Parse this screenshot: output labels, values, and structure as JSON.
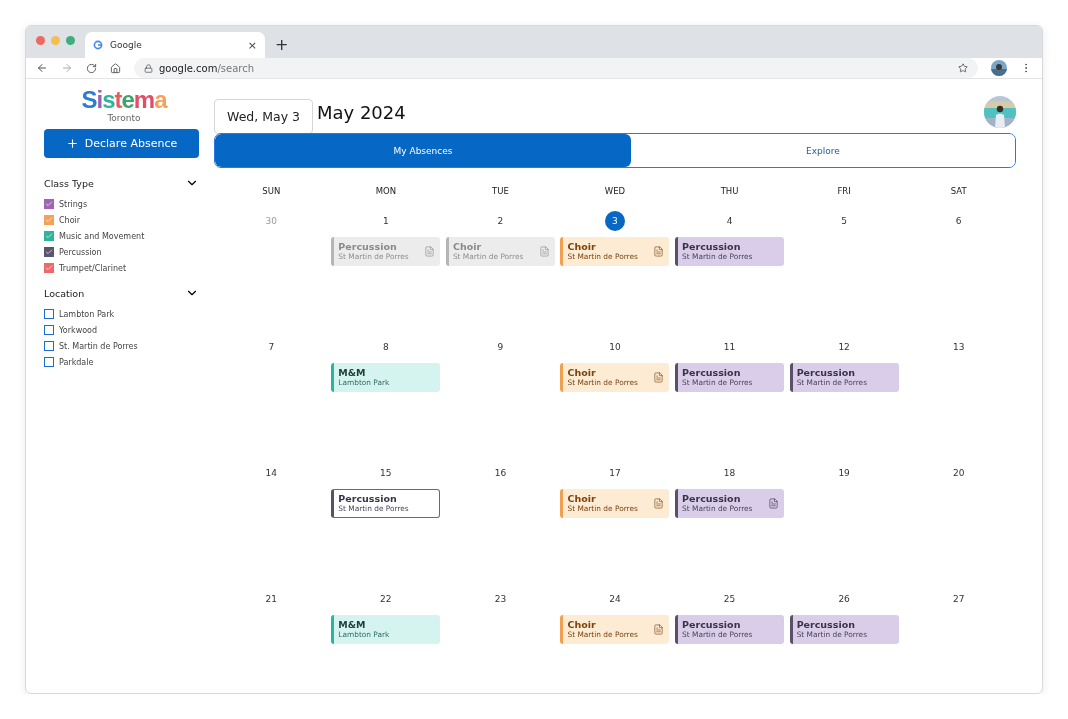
{
  "browser": {
    "tab_title": "Google",
    "new_tab": "+",
    "close_tab": "×",
    "url_host": "google.com",
    "url_path": "/search"
  },
  "sidebar": {
    "logo": "Sistema",
    "logo_sub": "Toronto",
    "declare_button": "Declare Absence",
    "sections": [
      {
        "title": "Class Type",
        "expanded": true,
        "items": [
          {
            "label": "Strings",
            "checked": true,
            "color": "#a064b4"
          },
          {
            "label": "Choir",
            "checked": true,
            "color": "#f4a259"
          },
          {
            "label": "Music and Movement",
            "checked": true,
            "color": "#2fb39b"
          },
          {
            "label": "Percussion",
            "checked": true,
            "color": "#5b5470"
          },
          {
            "label": "Trumpet/Clarinet",
            "checked": true,
            "color": "#ee6a6a"
          }
        ]
      },
      {
        "title": "Location",
        "expanded": true,
        "items": [
          {
            "label": "Lambton Park",
            "checked": false,
            "color": "#1a6fd0"
          },
          {
            "label": "Yorkwood",
            "checked": false,
            "color": "#1a6fd0"
          },
          {
            "label": "St. Martin de Porres",
            "checked": false,
            "color": "#1a6fd0"
          },
          {
            "label": "Parkdale",
            "checked": false,
            "color": "#1a6fd0"
          }
        ]
      }
    ]
  },
  "header": {
    "date_button": "Wed, May 3",
    "month_title": "May 2024"
  },
  "tabs": [
    {
      "label": "My Absences",
      "selected": true
    },
    {
      "label": "Explore",
      "selected": false
    }
  ],
  "calendar": {
    "weekdays": [
      "SUN",
      "MON",
      "TUE",
      "WED",
      "THU",
      "FRI",
      "SAT"
    ],
    "weeks": [
      {
        "days": [
          {
            "date": "30",
            "muted": true,
            "today": false
          },
          {
            "date": "1",
            "muted": false,
            "today": false,
            "events": [
              {
                "kind": "past",
                "title": "Percussion",
                "place": "St Martin de Porres",
                "note": true
              }
            ]
          },
          {
            "date": "2",
            "muted": false,
            "today": false,
            "events": [
              {
                "kind": "past",
                "title": "Choir",
                "place": "St Martin de Porres",
                "note": true
              }
            ]
          },
          {
            "date": "3",
            "muted": false,
            "today": true,
            "events": [
              {
                "kind": "choir",
                "title": "Choir",
                "place": "St Martin de Porres",
                "note": true
              }
            ]
          },
          {
            "date": "4",
            "muted": false,
            "today": false,
            "events": [
              {
                "kind": "percussion",
                "title": "Percussion",
                "place": "St Martin de Porres",
                "note": false
              }
            ]
          },
          {
            "date": "5",
            "muted": false,
            "today": false
          },
          {
            "date": "6",
            "muted": false,
            "today": false
          }
        ]
      },
      {
        "days": [
          {
            "date": "7",
            "muted": false,
            "today": false
          },
          {
            "date": "8",
            "muted": false,
            "today": false,
            "events": [
              {
                "kind": "movement",
                "title": "M&M",
                "place": "Lambton Park",
                "note": false
              }
            ]
          },
          {
            "date": "9",
            "muted": false,
            "today": false
          },
          {
            "date": "10",
            "muted": false,
            "today": false,
            "events": [
              {
                "kind": "choir",
                "title": "Choir",
                "place": "St Martin de Porres",
                "note": true
              }
            ]
          },
          {
            "date": "11",
            "muted": false,
            "today": false,
            "events": [
              {
                "kind": "percussion",
                "title": "Percussion",
                "place": "St Martin de Porres",
                "note": false
              }
            ]
          },
          {
            "date": "12",
            "muted": false,
            "today": false,
            "events": [
              {
                "kind": "percussion",
                "title": "Percussion",
                "place": "St Martin de Porres",
                "note": false
              }
            ]
          },
          {
            "date": "13",
            "muted": false,
            "today": false
          }
        ]
      },
      {
        "days": [
          {
            "date": "14",
            "muted": false,
            "today": false
          },
          {
            "date": "15",
            "muted": false,
            "today": false,
            "events": [
              {
                "kind": "outlined",
                "title": "Percussion",
                "place": "St Martin de Porres",
                "note": false
              }
            ]
          },
          {
            "date": "16",
            "muted": false,
            "today": false
          },
          {
            "date": "17",
            "muted": false,
            "today": false,
            "events": [
              {
                "kind": "choir",
                "title": "Choir",
                "place": "St Martin de Porres",
                "note": true
              }
            ]
          },
          {
            "date": "18",
            "muted": false,
            "today": false,
            "events": [
              {
                "kind": "percussion",
                "title": "Percussion",
                "place": "St Martin de Porres",
                "note": true
              }
            ]
          },
          {
            "date": "19",
            "muted": false,
            "today": false
          },
          {
            "date": "20",
            "muted": false,
            "today": false
          }
        ]
      },
      {
        "days": [
          {
            "date": "21",
            "muted": false,
            "today": false
          },
          {
            "date": "22",
            "muted": false,
            "today": false,
            "events": [
              {
                "kind": "movement",
                "title": "M&M",
                "place": "Lambton Park",
                "note": false
              }
            ]
          },
          {
            "date": "23",
            "muted": false,
            "today": false
          },
          {
            "date": "24",
            "muted": false,
            "today": false,
            "events": [
              {
                "kind": "choir",
                "title": "Choir",
                "place": "St Martin de Porres",
                "note": true
              }
            ]
          },
          {
            "date": "25",
            "muted": false,
            "today": false,
            "events": [
              {
                "kind": "percussion",
                "title": "Percussion",
                "place": "St Martin de Porres",
                "note": false
              }
            ]
          },
          {
            "date": "26",
            "muted": false,
            "today": false,
            "events": [
              {
                "kind": "percussion",
                "title": "Percussion",
                "place": "St Martin de Porres",
                "note": false
              }
            ]
          },
          {
            "date": "27",
            "muted": false,
            "today": false
          }
        ]
      }
    ]
  }
}
